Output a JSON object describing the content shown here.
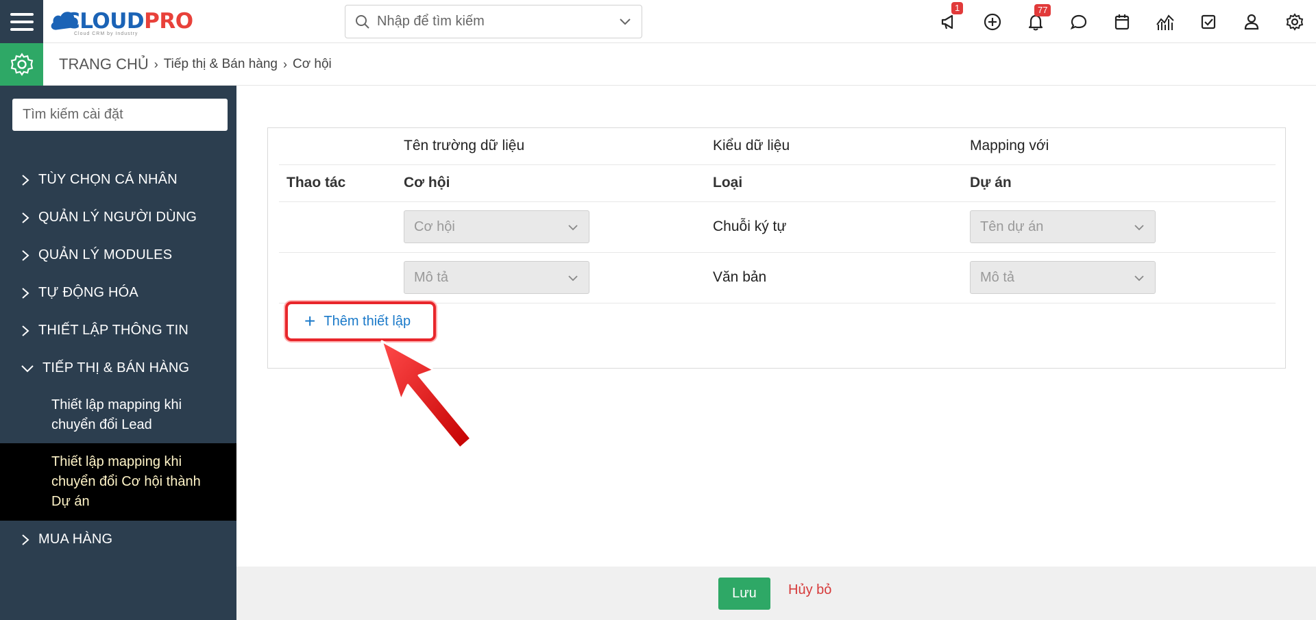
{
  "header": {
    "logo_main": "CLOUD",
    "logo_accent": "PRO",
    "logo_tagline": "Cloud CRM by Industry",
    "search_placeholder": "Nhập để tìm kiếm",
    "notifications": {
      "announcements_count": "1",
      "bell_count": "77"
    },
    "icons": [
      "megaphone-icon",
      "plus-circle-icon",
      "bell-icon",
      "chat-icon",
      "calendar-icon",
      "chart-icon",
      "checkbox-icon",
      "user-icon",
      "settings-icon"
    ]
  },
  "breadcrumb": {
    "home": "TRANG CHỦ",
    "level1": "Tiếp thị & Bán hàng",
    "level2": "Cơ hội"
  },
  "sidebar": {
    "search_placeholder": "Tìm kiếm cài đặt",
    "items": [
      {
        "label": "TÙY CHỌN CÁ NHÂN",
        "expanded": false
      },
      {
        "label": "QUẢN LÝ NGƯỜI DÙNG",
        "expanded": false
      },
      {
        "label": "QUẢN LÝ MODULES",
        "expanded": false
      },
      {
        "label": "TỰ ĐỘNG HÓA",
        "expanded": false
      },
      {
        "label": "THIẾT LẬP THÔNG TIN",
        "expanded": false
      },
      {
        "label": "TIẾP THỊ & BÁN HÀNG",
        "expanded": true
      },
      {
        "label": "MUA HÀNG",
        "expanded": false
      }
    ],
    "subitems": [
      {
        "label": "Thiết lập mapping khi chuyển đổi Lead",
        "active": false
      },
      {
        "label": "Thiết lập mapping khi chuyển đổi Cơ hội thành Dự án",
        "active": true
      }
    ]
  },
  "table": {
    "headers": {
      "field_name": "Tên trường dữ liệu",
      "data_type": "Kiểu dữ liệu",
      "mapping": "Mapping với"
    },
    "subheaders": {
      "action": "Thao tác",
      "source": "Cơ hội",
      "type": "Loại",
      "target": "Dự án"
    },
    "rows": [
      {
        "source": "Cơ hội",
        "type": "Chuỗi ký tự",
        "target": "Tên dự án"
      },
      {
        "source": "Mô tả",
        "type": "Văn bản",
        "target": "Mô tả"
      }
    ],
    "add_label": "Thêm thiết lập"
  },
  "footer": {
    "save_label": "Lưu",
    "cancel_label": "Hủy bỏ"
  },
  "colors": {
    "sidebar_bg": "#2c3e4f",
    "accent_green": "#2ea866",
    "link_blue": "#1a79c9",
    "highlight_red": "#e8262b"
  }
}
